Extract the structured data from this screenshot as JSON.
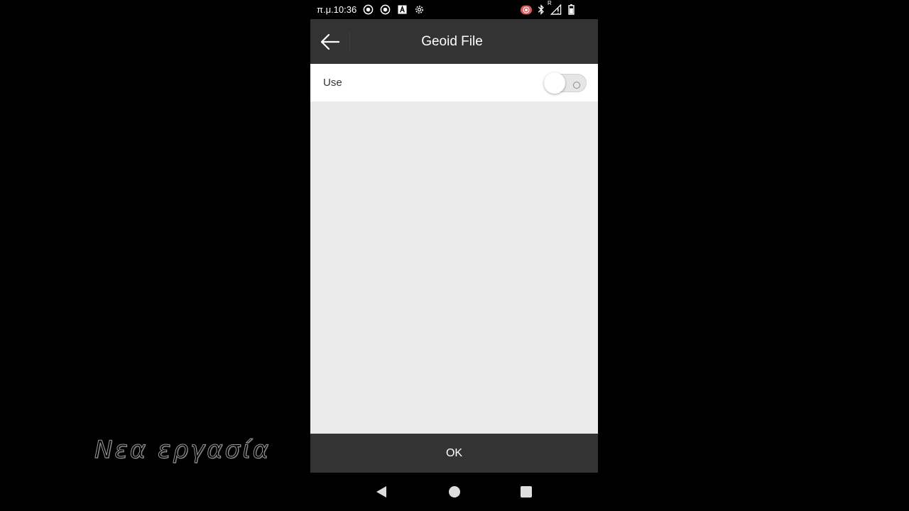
{
  "status_bar": {
    "time": "π.μ.10:36",
    "left_icons": [
      "record-icon",
      "record-icon",
      "font-a-icon",
      "gear-icon"
    ],
    "right_icons": [
      "screen-record-icon",
      "bluetooth-icon",
      "signal-roaming-icon",
      "battery-icon"
    ],
    "signal_badge": "R"
  },
  "app_bar": {
    "title": "Geoid File",
    "back_icon": "arrow-left-icon"
  },
  "settings": {
    "use_label": "Use",
    "use_enabled": false
  },
  "footer": {
    "ok_label": "OK"
  },
  "nav_bar": {
    "icons": [
      "nav-back-icon",
      "nav-home-icon",
      "nav-recents-icon"
    ]
  },
  "watermark": {
    "text": "Νεα εργασία"
  },
  "colors": {
    "app_bar_bg": "#333333",
    "content_bg": "#ebebeb",
    "row_bg": "#ffffff",
    "status_record_red": "#e05555"
  }
}
